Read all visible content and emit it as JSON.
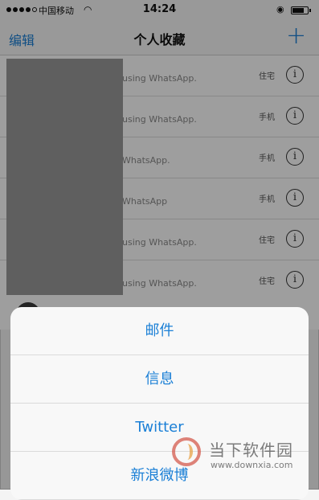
{
  "status_bar": {
    "carrier": "中国移动",
    "time": "14:24",
    "wifi_icon": "wifi-icon",
    "lock_icon": "rotation-lock-icon"
  },
  "nav": {
    "edit_label": "编辑",
    "title": "个人收藏",
    "add_label": "+"
  },
  "favorites": [
    {
      "subtitle": "using WhatsApp.",
      "label": "住宅"
    },
    {
      "subtitle": "using WhatsApp.",
      "label": "手机"
    },
    {
      "subtitle": "WhatsApp.",
      "label": "手机"
    },
    {
      "subtitle": "WhatsApp",
      "label": "手机"
    },
    {
      "subtitle": "using WhatsApp.",
      "label": "住宅"
    },
    {
      "subtitle": "using WhatsApp.",
      "label": "住宅"
    }
  ],
  "partial_row": {
    "name": ""
  },
  "share_sheet": {
    "items": [
      "邮件",
      "信息",
      "Twitter",
      "新浪微博"
    ]
  },
  "watermark": {
    "name": "当下软件园",
    "url": "www.downxia.com"
  },
  "colors": {
    "accent": "#1a7fd6",
    "background": "#f4f4f4"
  }
}
